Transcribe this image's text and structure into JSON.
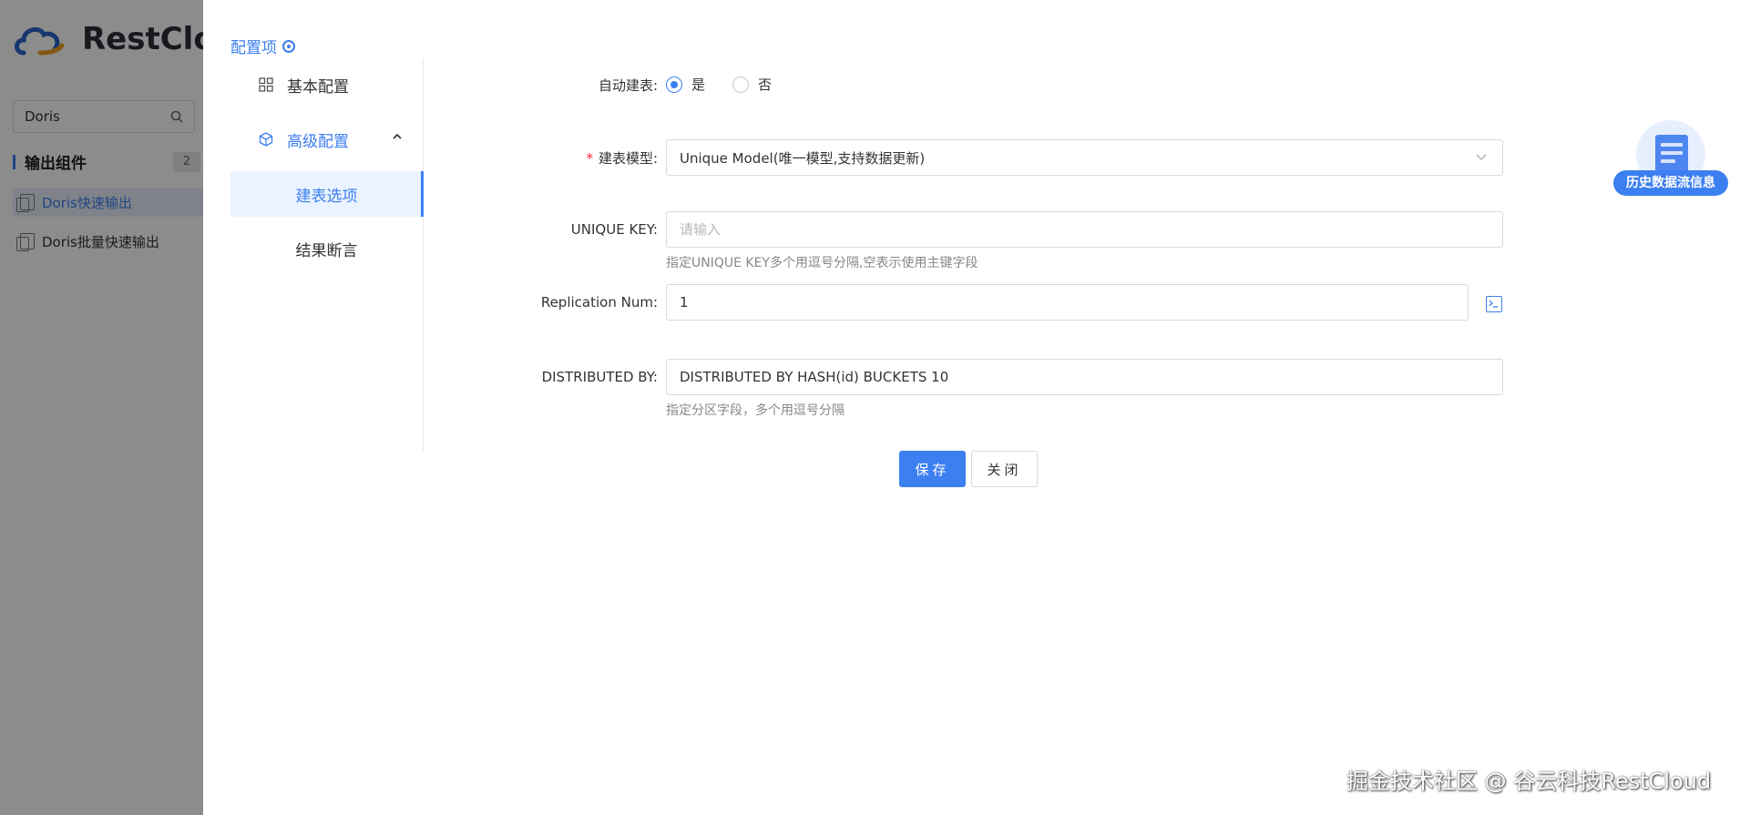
{
  "background": {
    "brand": "RestClo",
    "search_value": "Doris",
    "section_title": "输出组件",
    "section_count": "2",
    "items": [
      {
        "label": "Doris快速输出",
        "active": true
      },
      {
        "label": "Doris批量快速输出",
        "active": false
      }
    ]
  },
  "drawer": {
    "title": "配置项",
    "menu": {
      "basic": "基本配置",
      "advanced": "高级配置",
      "sub_table_options": "建表选项",
      "sub_result_assert": "结果断言"
    },
    "form": {
      "auto_create": {
        "label": "自动建表:",
        "options": [
          "是",
          "否"
        ],
        "selected": "是"
      },
      "model": {
        "label": "建表模型:",
        "value": "Unique Model(唯一模型,支持数据更新)"
      },
      "unique_key": {
        "label": "UNIQUE KEY:",
        "placeholder": "请输入",
        "hint": "指定UNIQUE KEY多个用逗号分隔,空表示使用主键字段"
      },
      "replication": {
        "label": "Replication Num:",
        "value": "1"
      },
      "distributed": {
        "label": "DISTRIBUTED BY:",
        "value": "DISTRIBUTED BY HASH(id) BUCKETS 10",
        "hint": "指定分区字段，多个用逗号分隔"
      }
    },
    "buttons": {
      "save": "保存",
      "close": "关闭"
    },
    "history_badge": "历史数据流信息"
  },
  "watermark": "掘金技术社区 @ 谷云科技RestCloud",
  "colors": {
    "accent": "#3c7ff0",
    "required": "#f5222d",
    "overlay": "rgba(0,0,0,0.45)"
  }
}
